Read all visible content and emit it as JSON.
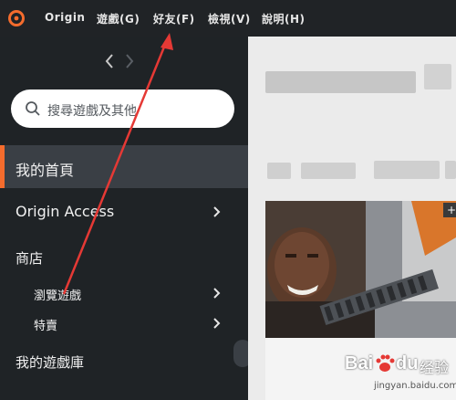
{
  "menubar": {
    "items": [
      {
        "label": "Origin"
      },
      {
        "label": "遊戲(G)"
      },
      {
        "label": "好友(F)"
      },
      {
        "label": "檢視(V)"
      },
      {
        "label": "說明(H)"
      }
    ]
  },
  "search": {
    "placeholder": "搜尋遊戲及其他"
  },
  "sidebar": {
    "home": "我的首頁",
    "origin_access": "Origin Access",
    "store": "商店",
    "browse_games": "瀏覽遊戲",
    "deals": "特賣",
    "library": "我的遊戲庫"
  },
  "watermark": {
    "brand": "Bai",
    "brand2": "du",
    "suffix": "经验",
    "url": "jingyan.baidu.com"
  },
  "colors": {
    "accent": "#f56c2d",
    "sidebar_bg": "#1f2326",
    "active_item_bg": "#3a3f45",
    "annotation_arrow": "#e53935"
  }
}
